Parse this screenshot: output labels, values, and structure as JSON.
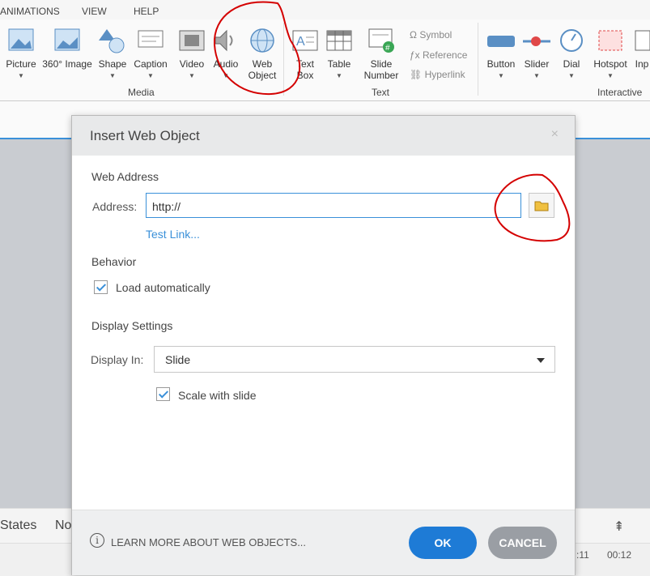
{
  "menu": {
    "animations": "ANIMATIONS",
    "view": "VIEW",
    "help": "HELP"
  },
  "ribbon": {
    "media_items": [
      "Picture",
      "360° Image",
      "Shape",
      "Caption",
      "Video",
      "Audio",
      "Web\nObject"
    ],
    "picture": "Picture",
    "image360": "360° Image",
    "shape": "Shape",
    "caption": "Caption",
    "video": "Video",
    "audio": "Audio",
    "web_object_1": "Web",
    "web_object_2": "Object",
    "media_group": "Media",
    "text_box_1": "Text",
    "text_box_2": "Box",
    "table": "Table",
    "slide_number_1": "Slide",
    "slide_number_2": "Number",
    "symbol": "Symbol",
    "reference": "Reference",
    "hyperlink": "Hyperlink",
    "text_group": "Text",
    "button": "Button",
    "slider": "Slider",
    "dial": "Dial",
    "hotspot": "Hotspot",
    "input": "Inp",
    "interactive_group": "Interactive"
  },
  "bottom": {
    "states": "States",
    "no": "No",
    "time1": ":11",
    "time2": "00:12"
  },
  "dialog": {
    "title": "Insert Web Object",
    "close": "×",
    "web_address_heading": "Web Address",
    "address_label": "Address:",
    "address_value": "http://",
    "test_link": "Test Link...",
    "behavior_heading": "Behavior",
    "load_auto": "Load automatically",
    "display_heading": "Display Settings",
    "display_in_label": "Display In:",
    "display_in_value": "Slide",
    "scale_with_slide": "Scale with slide",
    "info_icon": "i",
    "learn_more": "LEARN MORE ABOUT WEB OBJECTS...",
    "ok": "OK",
    "cancel": "CANCEL"
  },
  "colors": {
    "accent": "#1e7bd6",
    "annotation": "#d40000"
  }
}
